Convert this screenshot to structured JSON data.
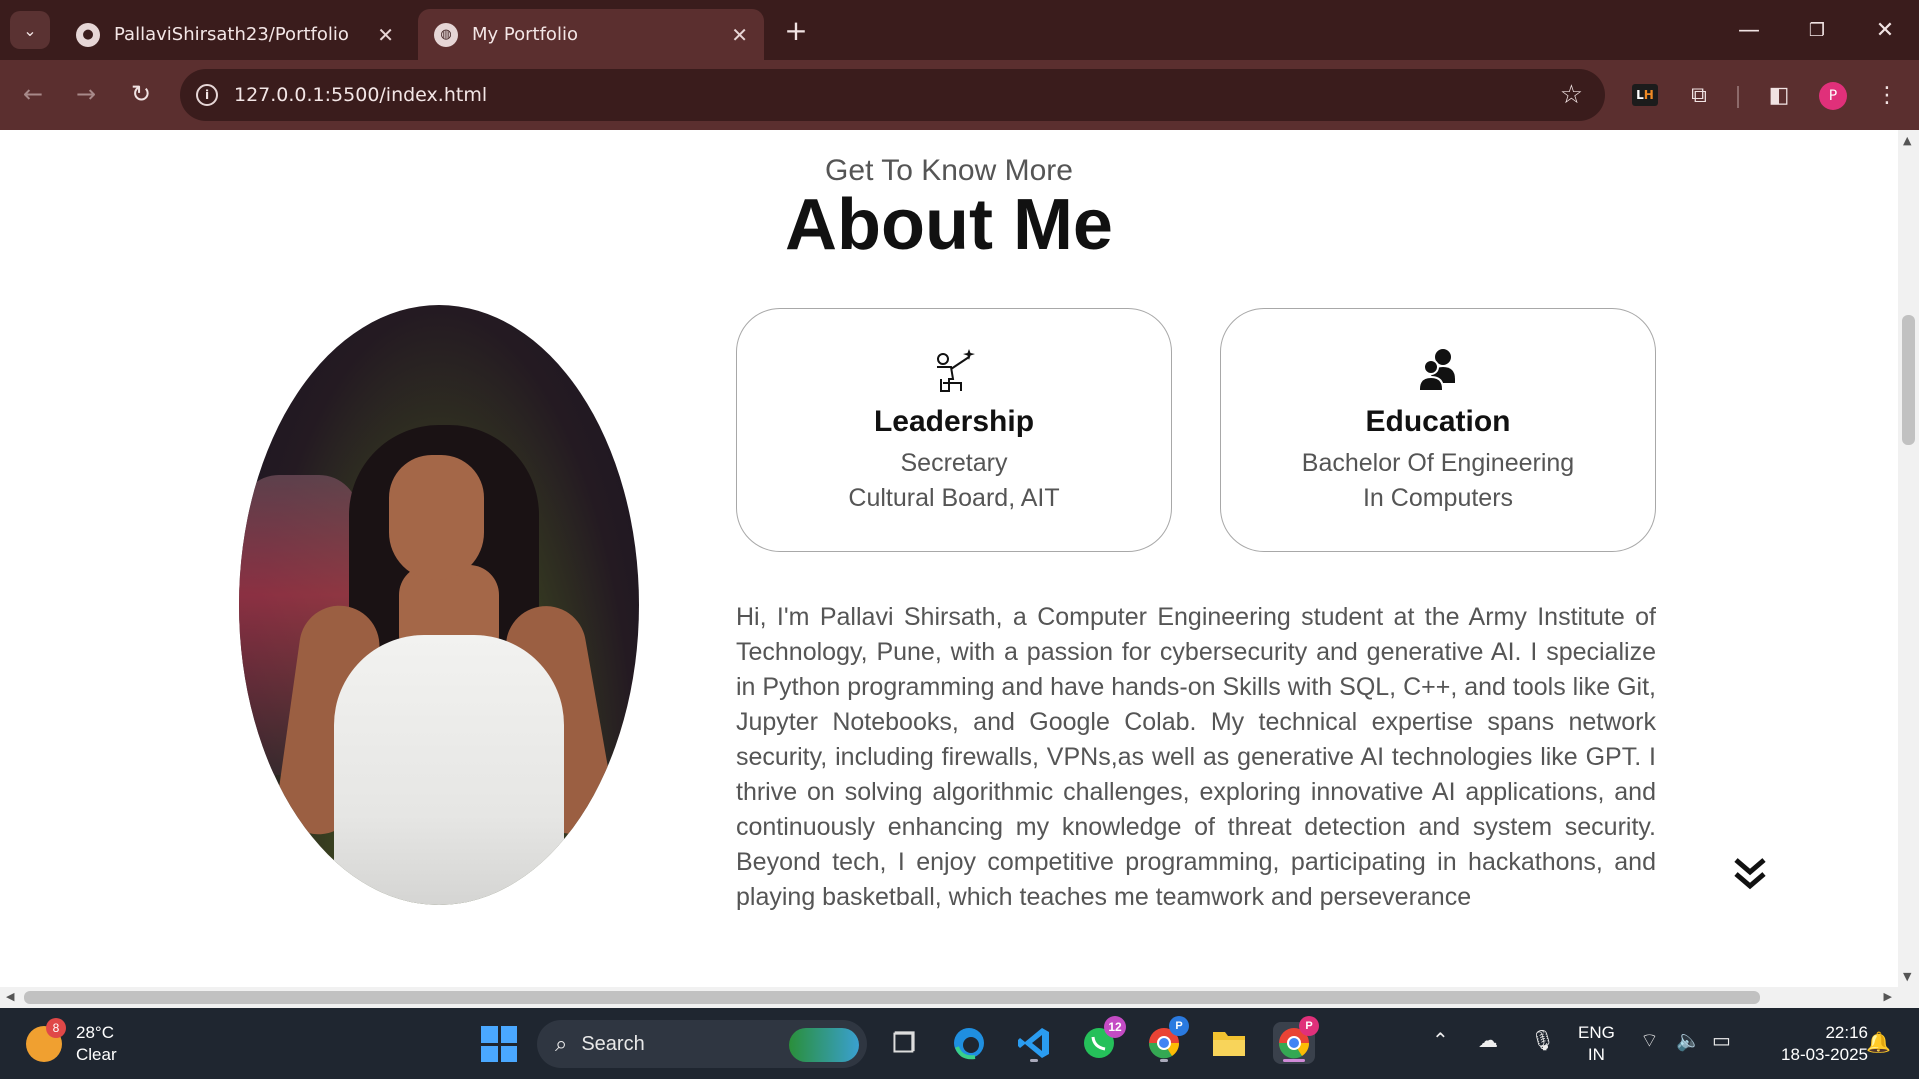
{
  "browser": {
    "tabs": [
      {
        "title": "PallaviShirsath23/Portfolio",
        "icon": "github-icon"
      },
      {
        "title": "My Portfolio",
        "icon": "globe-icon",
        "active": true
      }
    ],
    "url": "127.0.0.1:5500/index.html",
    "profile_initial": "P",
    "extension_lh": {
      "l": "L",
      "h": "H"
    }
  },
  "page": {
    "subtitle": "Get To Know More",
    "title": "About Me",
    "cards": [
      {
        "title": "Leadership",
        "line1": "Secretary",
        "line2": "Cultural Board, AIT",
        "icon": "leadership-icon"
      },
      {
        "title": "Education",
        "line1": "Bachelor Of Engineering",
        "line2": "In Computers",
        "icon": "education-icon"
      }
    ],
    "about_text": "Hi, I'm Pallavi Shirsath, a Computer Engineering student at the Army Institute of Technology, Pune, with a passion for cybersecurity and generative AI. I specialize in Python programming and have hands-on Skills with SQL, C++, and tools like Git, Jupyter Notebooks, and Google Colab. My technical expertise spans network security, including firewalls, VPNs,as well as generative AI technologies like GPT. I thrive on solving algorithmic challenges, exploring innovative AI applications, and continuously enhancing my knowledge of threat detection and system security. Beyond tech, I enjoy competitive programming, participating in hackathons, and playing basketball, which teaches me teamwork and perseverance"
  },
  "taskbar": {
    "weather_badge": "8",
    "temperature": "28°C",
    "condition": "Clear",
    "search_placeholder": "Search",
    "whatsapp_count": "12",
    "chrome_profile_badge": "P",
    "lang_line1": "ENG",
    "lang_line2": "IN",
    "time": "22:16",
    "date": "18-03-2025"
  },
  "colors": {
    "chrome_dark": "#3a1c1c",
    "chrome_mid": "#5b2f2f",
    "taskbar": "#1f2630",
    "accent_profile": "#e0307a"
  }
}
